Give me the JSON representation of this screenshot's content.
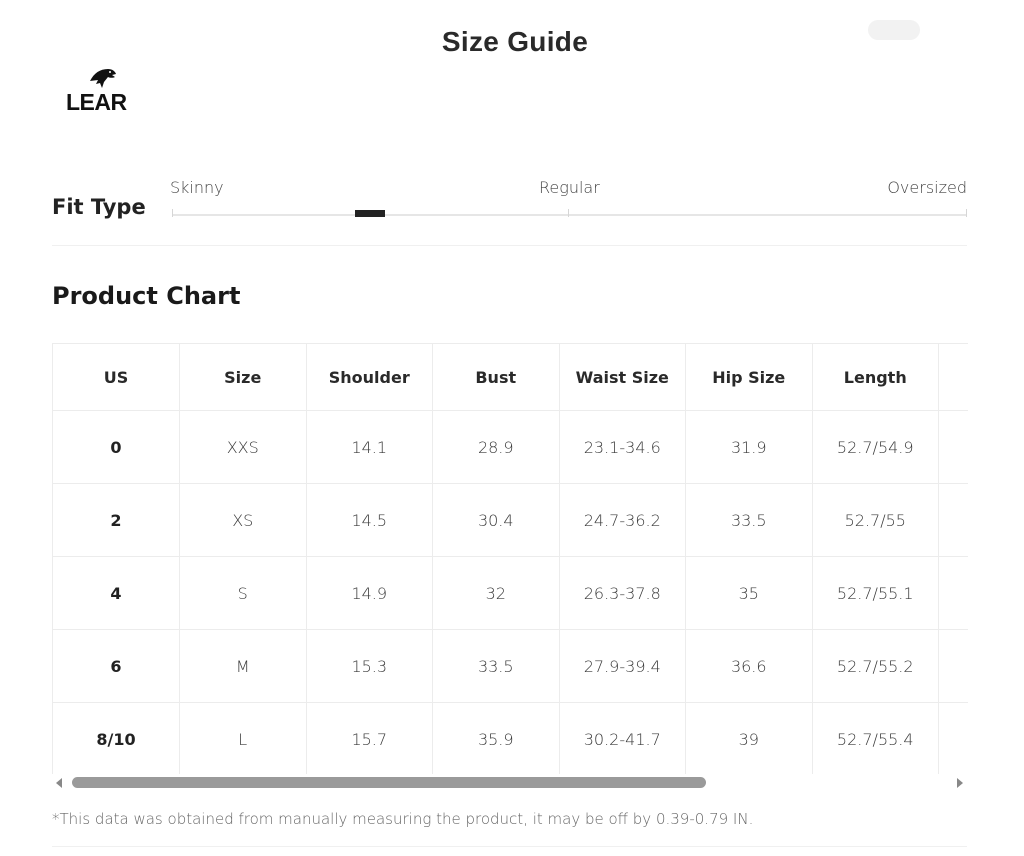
{
  "page": {
    "title": "Size Guide"
  },
  "brand": {
    "logo_text": "LEAR",
    "logo_icon": "eagle-icon"
  },
  "fit_type": {
    "label": "Fit Type",
    "options": [
      "Skinny",
      "Regular",
      "Oversized"
    ],
    "position": "between Skinny and Regular"
  },
  "product_chart": {
    "heading": "Product Chart",
    "columns": [
      "US",
      "Size",
      "Shoulder",
      "Bust",
      "Waist Size",
      "Hip Size",
      "Length",
      ""
    ],
    "rows": [
      [
        "0",
        "XXS",
        "14.1",
        "28.9",
        "23.1-34.6",
        "31.9",
        "52.7/54.9",
        ""
      ],
      [
        "2",
        "XS",
        "14.5",
        "30.4",
        "24.7-36.2",
        "33.5",
        "52.7/55",
        ""
      ],
      [
        "4",
        "S",
        "14.9",
        "32",
        "26.3-37.8",
        "35",
        "52.7/55.1",
        ""
      ],
      [
        "6",
        "M",
        "15.3",
        "33.5",
        "27.9-39.4",
        "36.6",
        "52.7/55.2",
        ""
      ],
      [
        "8/10",
        "L",
        "15.7",
        "35.9",
        "30.2-41.7",
        "39",
        "52.7/55.4",
        ""
      ]
    ]
  },
  "note": "*This data was obtained from manually measuring the product, it may be off by 0.39-0.79 IN.",
  "colors": {
    "text": "#222222",
    "border": "#ececec",
    "marker": "#222222",
    "scroll_thumb": "#9a9a9a"
  }
}
